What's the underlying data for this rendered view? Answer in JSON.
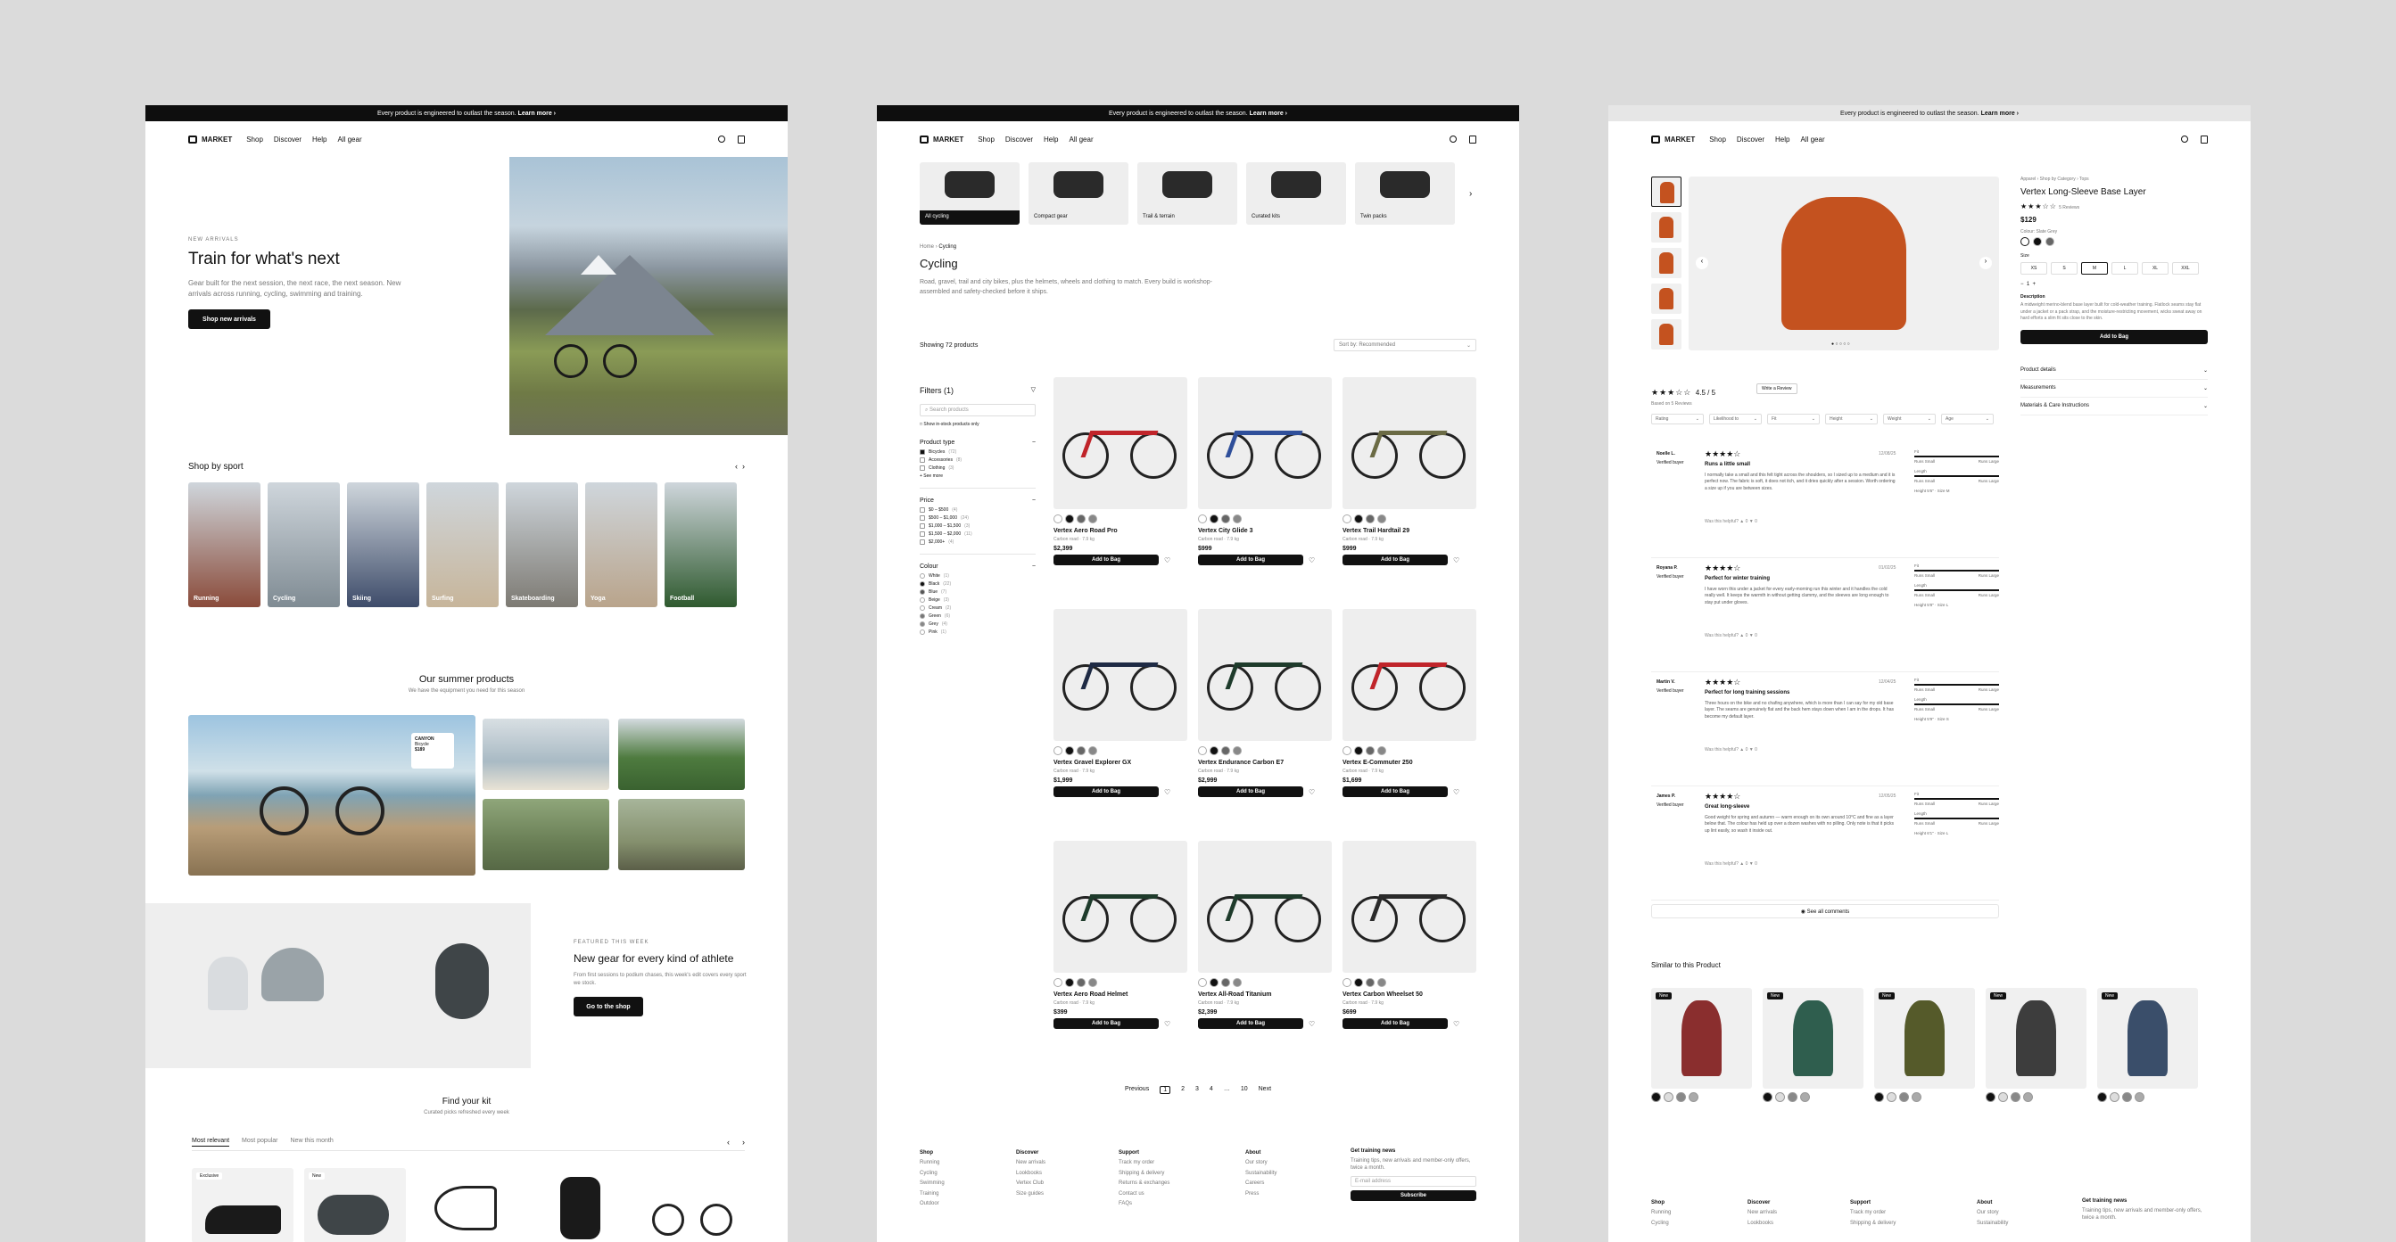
{
  "banner": "Every product is engineered to outlast the season.",
  "banner_link": "Learn more ›",
  "brand": "MARKET",
  "nav": {
    "shop": "Shop",
    "discover": "Discover",
    "help": "Help",
    "all": "All gear"
  },
  "home": {
    "eyebrow": "NEW ARRIVALS",
    "title": "Train for what's next",
    "text": "Gear built for the next session, the next race, the next season. New arrivals across running, cycling, swimming and training.",
    "cta": "Shop new arrivals",
    "sport_title": "Shop by sport",
    "sports": [
      "Running",
      "Cycling",
      "Skiing",
      "Surfing",
      "Skateboarding",
      "Yoga",
      "Football"
    ],
    "summer_title": "Our summer products",
    "summer_sub": "We have the equipment you need for this season",
    "tag_brand": "CANYON",
    "tag_model": "Bicycle",
    "tag_price": "$189",
    "feat_eyebrow": "FEATURED THIS WEEK",
    "feat_title": "New gear for every kind of athlete",
    "feat_text": "From first sessions to podium chases, this week's edit covers every sport we stock.",
    "feat_cta": "Go to the shop",
    "kit_title": "Find your kit",
    "kit_sub": "Curated picks refreshed every week",
    "kit_tabs": [
      "Most relevant",
      "Most popular",
      "New this month"
    ],
    "kit_badges": [
      "Exclusive",
      "New"
    ]
  },
  "list": {
    "categories": [
      "All cycling",
      "Compact gear",
      "Trail & terrain",
      "Curated kits",
      "Twin packs"
    ],
    "crumb_home": "Home",
    "crumb_sep": "›",
    "crumb_cur": "Cycling",
    "title": "Cycling",
    "desc": "Road, gravel, trail and city bikes, plus the helmets, wheels and clothing to match. Every build is workshop-assembled and safety-checked before it ships.",
    "showing": "Showing 72 products",
    "sort": "Sort by: Recommended",
    "filters": "Filters (1)",
    "search_ph": "Search products",
    "instock": "Show in-stock products only",
    "ptype": "Product type",
    "ptype_items": [
      {
        "l": "Bicycles",
        "c": "(72)"
      },
      {
        "l": "Accessories",
        "c": "(8)"
      },
      {
        "l": "Clothing",
        "c": "(3)"
      }
    ],
    "see_more": "+ See more",
    "price": "Price",
    "price_items": [
      {
        "l": "$0 – $500",
        "c": "(4)"
      },
      {
        "l": "$500 – $1,000",
        "c": "(24)"
      },
      {
        "l": "$1,000 – $1,500",
        "c": "(3)"
      },
      {
        "l": "$1,500 – $2,000",
        "c": "(11)"
      },
      {
        "l": "$2,000+",
        "c": "(4)"
      }
    ],
    "colour": "Colour",
    "colour_items": [
      {
        "l": "White",
        "c": "(1)",
        "h": "#ffffff"
      },
      {
        "l": "Black",
        "c": "(22)",
        "h": "#111111"
      },
      {
        "l": "Blue",
        "c": "(7)",
        "h": "#555555"
      },
      {
        "l": "Beige",
        "c": "(3)",
        "h": "#ffffff"
      },
      {
        "l": "Cream",
        "c": "(2)",
        "h": "#ffffff"
      },
      {
        "l": "Green",
        "c": "(6)",
        "h": "#777777"
      },
      {
        "l": "Grey",
        "c": "(4)",
        "h": "#888888"
      },
      {
        "l": "Pink",
        "c": "(1)",
        "h": "#ffffff"
      }
    ],
    "products": [
      {
        "n": "Vertex Aero Road Pro",
        "m": "Carbon road · 7.9 kg",
        "p": "$2,399",
        "c": "#c0242a"
      },
      {
        "n": "Vertex City Glide 3",
        "m": "Carbon road · 7.9 kg",
        "p": "$999",
        "c": "#2f4f9a"
      },
      {
        "n": "Vertex Trail Hardtail 29",
        "m": "Carbon road · 7.9 kg",
        "p": "$999",
        "c": "#6b6b45"
      },
      {
        "n": "Vertex Gravel Explorer GX",
        "m": "Carbon road · 7.9 kg",
        "p": "$1,999",
        "c": "#1e2a44"
      },
      {
        "n": "Vertex Endurance Carbon E7",
        "m": "Carbon road · 7.9 kg",
        "p": "$2,999",
        "c": "#1e3b2b"
      },
      {
        "n": "Vertex E-Commuter 250",
        "m": "Carbon road · 7.9 kg",
        "p": "$1,699",
        "c": "#c0242a"
      },
      {
        "n": "Vertex Aero Road Helmet",
        "m": "Carbon road · 7.9 kg",
        "p": "$399",
        "c": "#1e3b2b"
      },
      {
        "n": "Vertex All-Road Titanium",
        "m": "Carbon road · 7.9 kg",
        "p": "$2,399",
        "c": "#1e3b2b"
      },
      {
        "n": "Vertex Carbon Wheelset 50",
        "m": "Carbon road · 7.9 kg",
        "p": "$699",
        "c": "#2a2a2a"
      }
    ],
    "add": "Add to Bag",
    "pag": [
      "Previous",
      "1",
      "2",
      "3",
      "4",
      "…",
      "10",
      "Next"
    ],
    "footer": {
      "shop": "Shop",
      "shop_items": [
        "Running",
        "Cycling",
        "Swimming",
        "Training",
        "Outdoor"
      ],
      "disc": "Discover",
      "disc_items": [
        "New arrivals",
        "Lookbooks",
        "Vertex Club",
        "Size guides"
      ],
      "supp": "Support",
      "supp_items": [
        "Track my order",
        "Shipping & delivery",
        "Returns & exchanges",
        "Contact us",
        "FAQs"
      ],
      "about": "About",
      "about_items": [
        "Our story",
        "Sustainability",
        "Careers",
        "Press"
      ],
      "news": "Get training news",
      "news_text": "Training tips, new arrivals and member-only offers, twice a month.",
      "email_ph": "E-mail address",
      "subscribe": "Subscribe"
    }
  },
  "pdp": {
    "crumb": "Apparel › Shop by Category › Tops",
    "title": "Vertex Long-Sleeve Base Layer",
    "reviews_link": "5 Reviews",
    "price": "$129",
    "colour_label": "Colour: Slate Grey",
    "size_label": "Size",
    "sizes": [
      "XS",
      "S",
      "M",
      "L",
      "XL",
      "XXL"
    ],
    "qty": "1",
    "desc_label": "Description",
    "desc": "A midweight merino-blend base layer built for cold-weather training. Flatlock seams stay flat under a jacket or a pack strap, and the moisture-restricting movement, wicks sweat away on hard efforts a slim fit sits close to the skin.",
    "add": "Add to Bag",
    "acc": [
      "Product details",
      "Measurements",
      "Materials & Care Instructions"
    ],
    "rating": "4.5 / 5",
    "based": "Based on 5 Reviews",
    "write": "Write a Review",
    "filters": [
      "Rating",
      "Likelihood to",
      "Fit",
      "Height",
      "Weight",
      "Age"
    ],
    "reviews": [
      {
        "name": "Noelle L.",
        "ver": "Verified buyer",
        "date": "12/08/25",
        "title": "Runs a little small",
        "text": "I normally take a small and this felt tight across the shoulders, so I sized up to a medium and it is perfect now. The fabric is soft, it does not itch, and it dries quickly after a session. Worth ordering a size up if you are between sizes.",
        "h": "Height 5'6\" · Size M"
      },
      {
        "name": "Royana P.",
        "ver": "Verified buyer",
        "date": "01/02/25",
        "title": "Perfect for winter training",
        "text": "I have worn this under a jacket for every early-morning run this winter and it handles the cold really well. It keeps the warmth in without getting clammy, and the sleeves are long enough to stay put under gloves.",
        "h": "Height 5'8\" · Size L"
      },
      {
        "name": "Martin V.",
        "ver": "Verified buyer",
        "date": "12/04/25",
        "title": "Perfect for long training sessions",
        "text": "Three hours on the bike and no chafing anywhere, which is more than I can say for my old base layer. The seams are genuinely flat and the back hem stays down when I am in the drops. It has become my default layer.",
        "h": "Height 5'9\" · Size S"
      },
      {
        "name": "James P.",
        "ver": "Verified buyer",
        "date": "12/05/25",
        "title": "Great long-sleeve",
        "text": "Good weight for spring and autumn — warm enough on its own around 10°C and fine as a layer below that. The colour has held up over a dozen washes with no pilling. Only note is that it picks up lint easily, so wash it inside out.",
        "h": "Height 6'1\" · Size L"
      }
    ],
    "helpful": "Was this helpful?",
    "fit": "Fit",
    "runs_small": "Runs Small",
    "runs_large": "Runs Large",
    "length": "Length",
    "see_all": "See all comments",
    "similar": "Similar to this Product",
    "new": "New",
    "sim_colors": [
      "#8a2e2e",
      "#2f5e4e",
      "#555a2a",
      "#3d3d3d",
      "#3a4e6a"
    ],
    "footer": {
      "shop": "Shop",
      "disc": "Discover",
      "supp": "Support",
      "about": "About",
      "news": "Get training news",
      "shop_items": [
        "Running",
        "Cycling"
      ],
      "disc_items": [
        "New arrivals",
        "Lookbooks"
      ],
      "supp_items": [
        "Track my order",
        "Shipping & delivery"
      ],
      "about_items": [
        "Our story",
        "Sustainability"
      ],
      "news_text": "Training tips, new arrivals and member-only offers, twice a month."
    }
  }
}
